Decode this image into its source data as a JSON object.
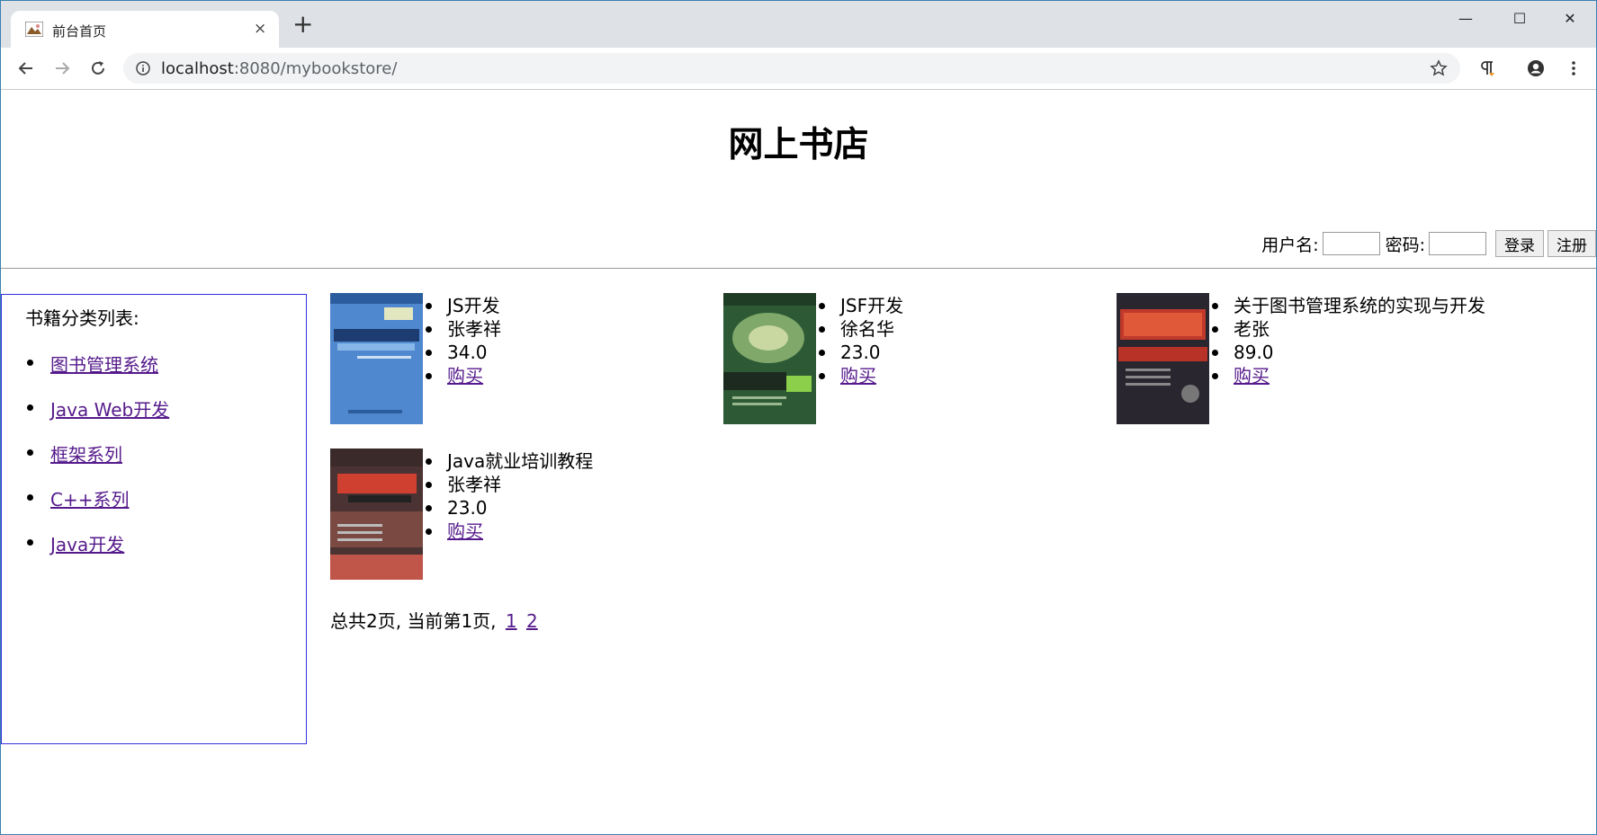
{
  "browser": {
    "tab_title": "前台首页",
    "close_glyph": "×",
    "new_tab_glyph": "+",
    "url_host": "localhost",
    "url_rest": ":8080/mybookstore/",
    "minimize_glyph": "—",
    "maximize_glyph": "☐",
    "window_close_glyph": "✕",
    "accent": "#3c7fb1"
  },
  "header": {
    "site_title": "网上书店"
  },
  "login": {
    "username_label": "用户名:",
    "password_label": "密码:",
    "username_value": "",
    "password_value": "",
    "login_button": "登录",
    "register_button": "注册"
  },
  "sidebar": {
    "title": "书籍分类列表:",
    "categories": [
      {
        "label": "图书管理系统"
      },
      {
        "label": "Java Web开发"
      },
      {
        "label": "框架系列"
      },
      {
        "label": "C++系列"
      },
      {
        "label": "Java开发"
      }
    ]
  },
  "books": [
    {
      "title": "JS开发",
      "author": "张孝祥",
      "price": "34.0",
      "buy": "购买",
      "cover_icon": "javascript-book-cover-icon",
      "cover_color": "#3e7bc9"
    },
    {
      "title": "JSF开发",
      "author": "徐名华",
      "price": "23.0",
      "buy": "购买",
      "cover_icon": "jsf-book-cover-icon",
      "cover_color": "#2f6b3a"
    },
    {
      "title": "关于图书管理系统的实现与开发",
      "author": "老张",
      "price": "89.0",
      "buy": "购买",
      "cover_icon": "j2ee-book-cover-icon",
      "cover_color": "#2a2630"
    },
    {
      "title": "Java就业培训教程",
      "author": "张孝祥",
      "price": "23.0",
      "buy": "购买",
      "cover_icon": "java-book-cover-icon",
      "cover_color": "#5a3a36"
    }
  ],
  "pager": {
    "text": "总共2页, 当前第1页,",
    "pages": [
      "1",
      "2"
    ]
  }
}
